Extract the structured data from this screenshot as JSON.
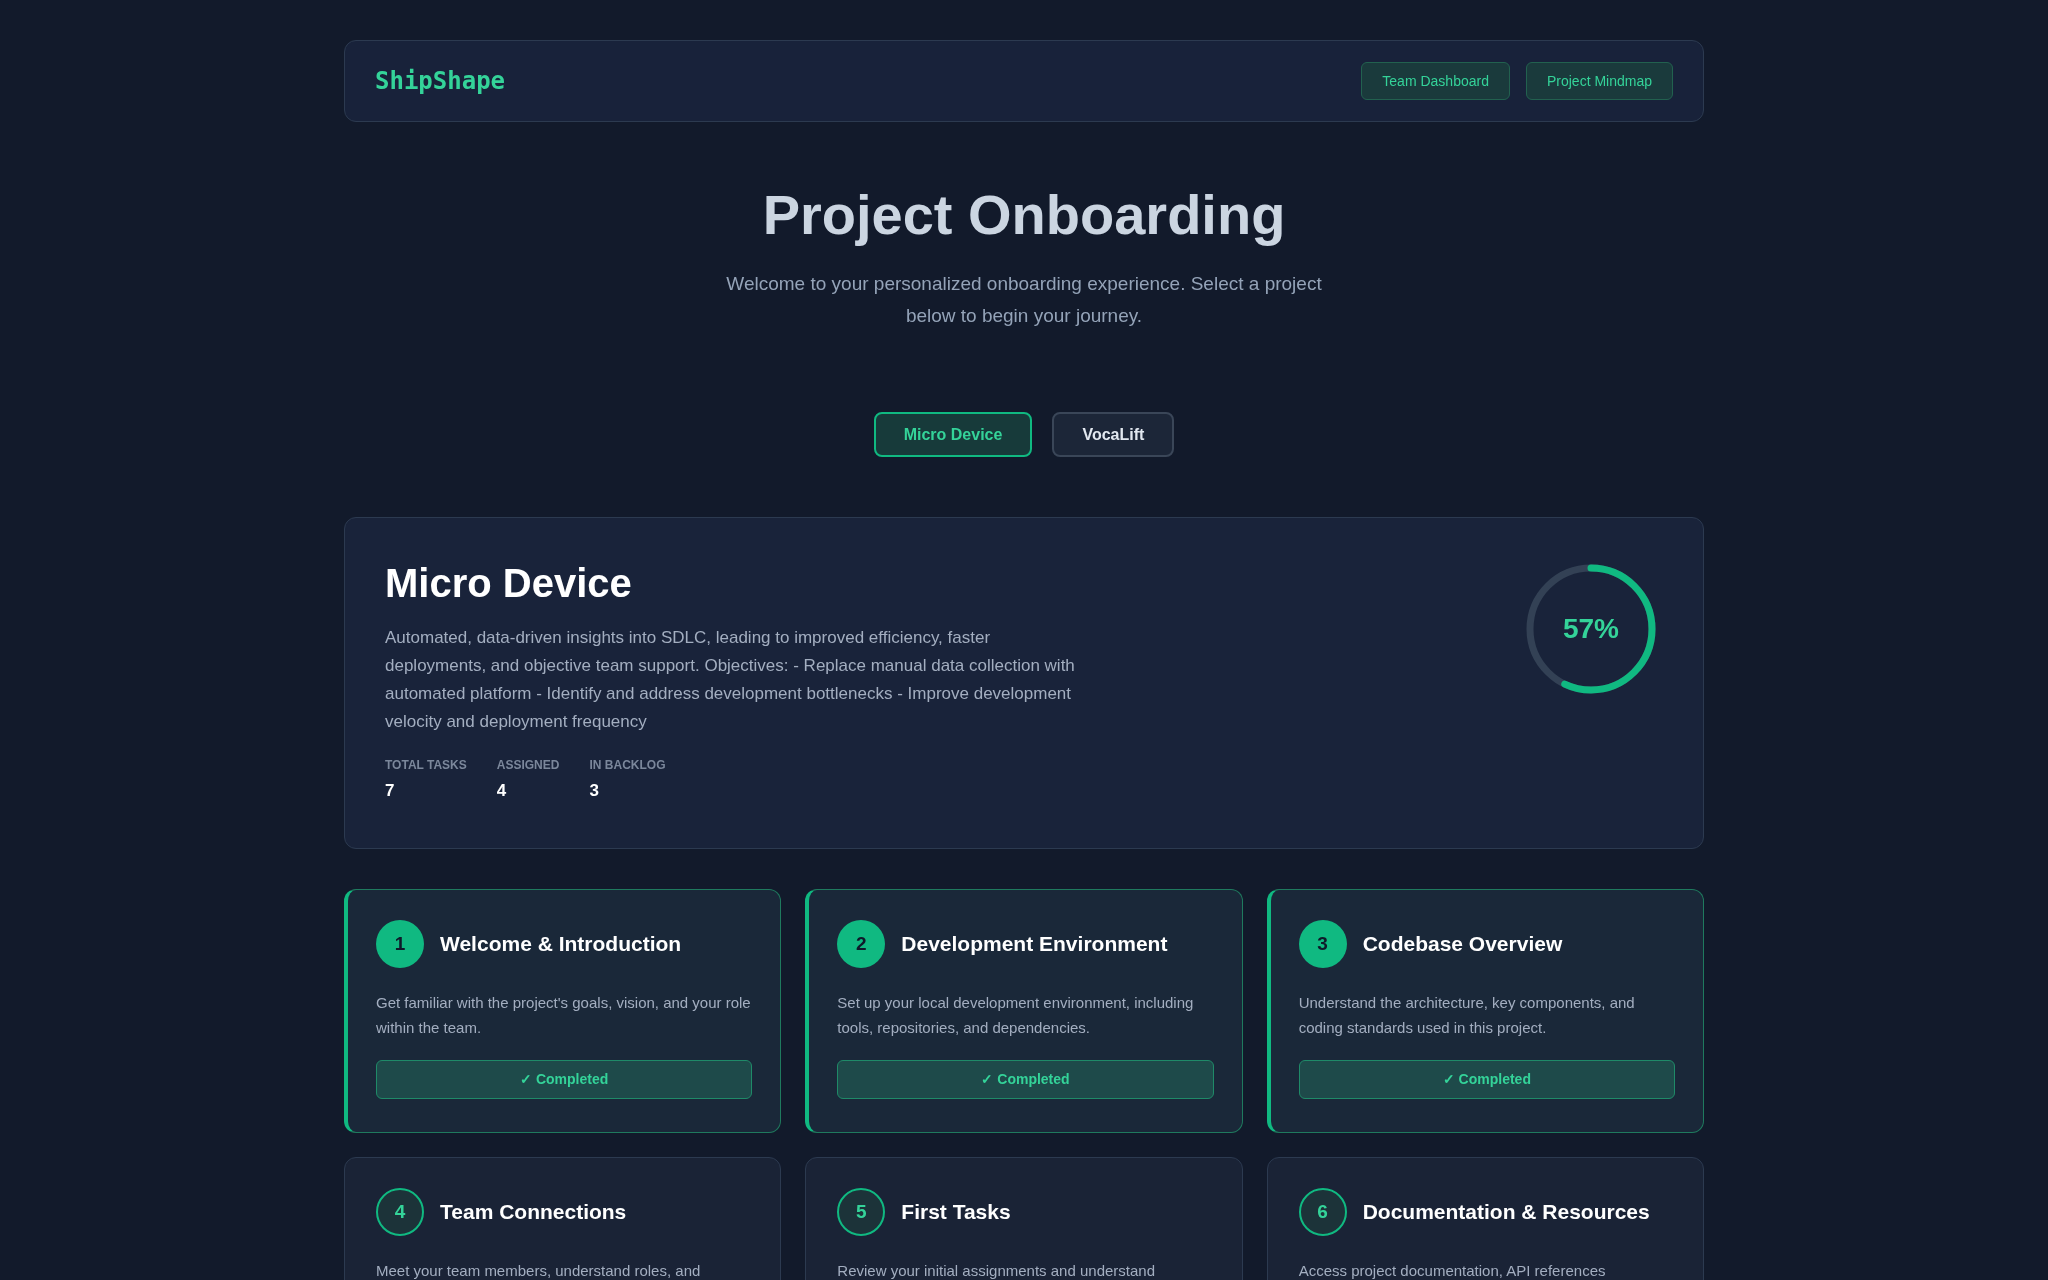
{
  "brand": "ShipShape",
  "nav": [
    "Team Dashboard",
    "Project Mindmap"
  ],
  "hero": {
    "title": "Project Onboarding",
    "subtitle": "Welcome to your personalized onboarding experience. Select a project below to begin your journey."
  },
  "project_tabs": [
    {
      "label": "Micro Device",
      "selected": true
    },
    {
      "label": "VocaLift",
      "selected": false
    }
  ],
  "project": {
    "name": "Micro Device",
    "description": "Automated, data-driven insights into SDLC, leading to improved efficiency, faster deployments, and objective team support. Objectives: - Replace manual data collection with automated platform - Identify and address development bottlenecks - Improve development velocity and deployment frequency",
    "stats": [
      {
        "label": "TOTAL TASKS",
        "value": "7"
      },
      {
        "label": "ASSIGNED",
        "value": "4"
      },
      {
        "label": "IN BACKLOG",
        "value": "3"
      }
    ],
    "progress": {
      "level": 0.57,
      "reading": "57%"
    }
  },
  "steps": [
    {
      "number": "1",
      "title": "Welcome & Introduction",
      "description": "Get familiar with the project's goals, vision, and your role within the team.",
      "completed": true,
      "status": "✓ Completed"
    },
    {
      "number": "2",
      "title": "Development Environment",
      "description": "Set up your local development environment, including tools, repositories, and dependencies.",
      "completed": true,
      "status": "✓ Completed"
    },
    {
      "number": "3",
      "title": "Codebase Overview",
      "description": "Understand the architecture, key components, and coding standards used in this project.",
      "completed": true,
      "status": "✓ Completed"
    },
    {
      "number": "4",
      "title": "Team Connections",
      "description": "Meet your team members, understand roles, and",
      "completed": false
    },
    {
      "number": "5",
      "title": "First Tasks",
      "description": "Review your initial assignments and understand",
      "completed": false
    },
    {
      "number": "6",
      "title": "Documentation & Resources",
      "description": "Access project documentation, API references",
      "completed": false
    }
  ]
}
